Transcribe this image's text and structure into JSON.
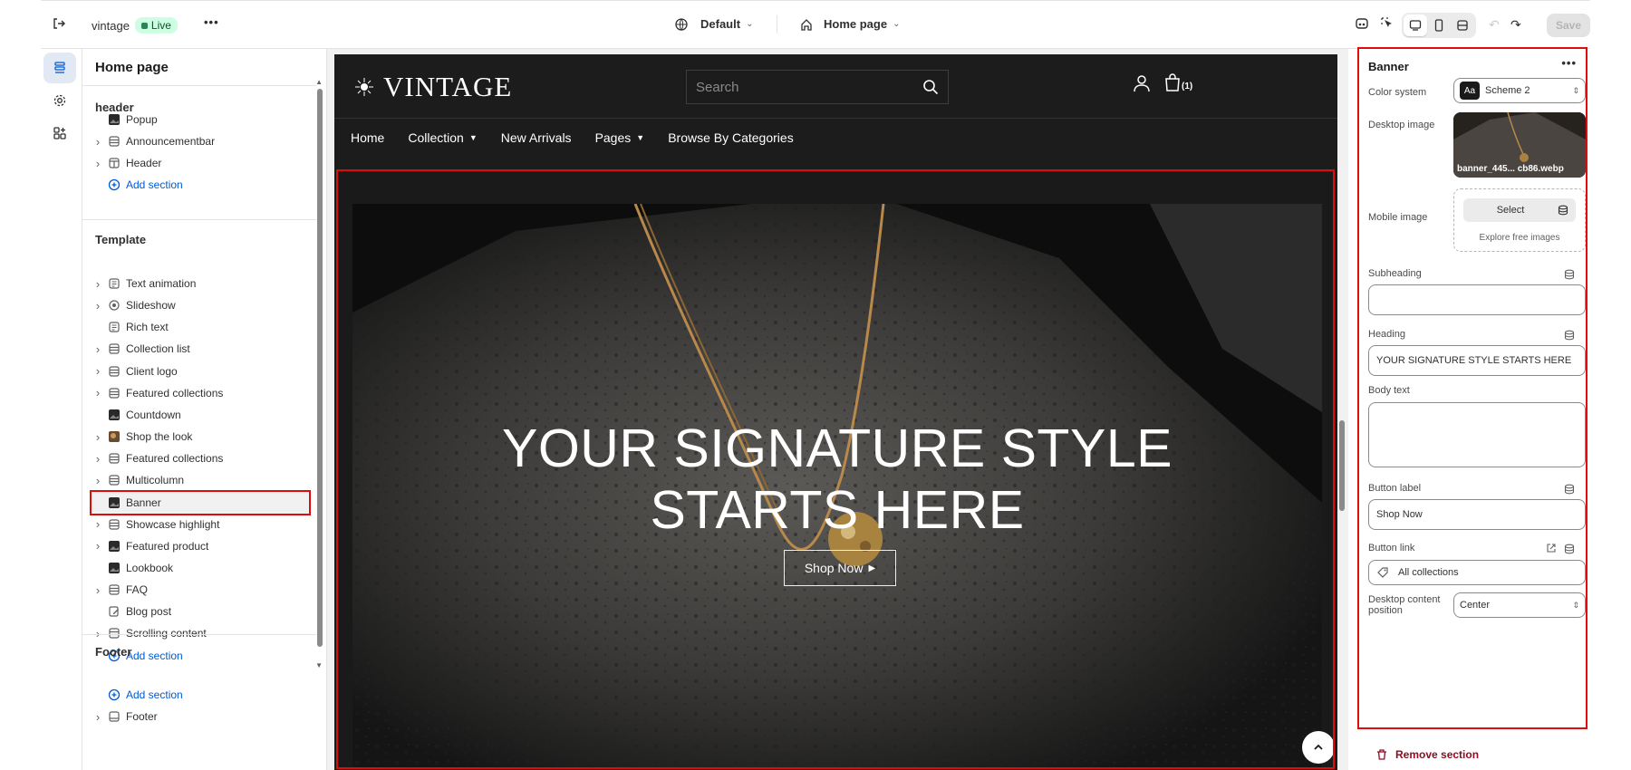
{
  "topbar": {
    "store_name": "vintage",
    "live_badge": "Live",
    "theme": "Default",
    "page": "Home page",
    "save_label": "Save"
  },
  "tree": {
    "title": "Home page",
    "header_group": {
      "title": "header",
      "items": [
        {
          "label": "Popup",
          "icon": "image-dark-icon",
          "expandable": false
        },
        {
          "label": "Announcementbar",
          "icon": "section-icon",
          "expandable": true
        },
        {
          "label": "Header",
          "icon": "header-layout-icon",
          "expandable": true
        },
        {
          "label": "Add section",
          "icon": "add-circle-icon",
          "add": true
        }
      ]
    },
    "template_group": {
      "title": "Template",
      "items": [
        {
          "label": "Text animation",
          "icon": "text-block-icon",
          "expandable": true
        },
        {
          "label": "Slideshow",
          "icon": "slideshow-icon",
          "expandable": true
        },
        {
          "label": "Rich text",
          "icon": "text-block-icon",
          "expandable": false
        },
        {
          "label": "Collection list",
          "icon": "section-icon",
          "expandable": true
        },
        {
          "label": "Client logo",
          "icon": "section-icon",
          "expandable": true
        },
        {
          "label": "Featured collections",
          "icon": "section-icon",
          "expandable": true
        },
        {
          "label": "Countdown",
          "icon": "image-dark-icon",
          "expandable": false
        },
        {
          "label": "Shop the look",
          "icon": "image-color-icon",
          "expandable": true
        },
        {
          "label": "Featured collections",
          "icon": "section-icon",
          "expandable": true
        },
        {
          "label": "Multicolumn",
          "icon": "section-icon",
          "expandable": true
        },
        {
          "label": "Banner",
          "icon": "image-dark-icon",
          "expandable": false,
          "selected": true
        },
        {
          "label": "Showcase highlight",
          "icon": "section-icon",
          "expandable": true
        },
        {
          "label": "Featured product",
          "icon": "image-dark-icon",
          "expandable": true
        },
        {
          "label": "Lookbook",
          "icon": "image-dark-icon",
          "expandable": false
        },
        {
          "label": "FAQ",
          "icon": "section-icon",
          "expandable": true
        },
        {
          "label": "Blog post",
          "icon": "edit-doc-icon",
          "expandable": false
        },
        {
          "label": "Scrolling content",
          "icon": "section-icon",
          "expandable": true
        },
        {
          "label": "Add section",
          "icon": "add-circle-icon",
          "add": true
        }
      ]
    },
    "footer_group": {
      "title": "Footer",
      "items": [
        {
          "label": "Add section",
          "icon": "add-circle-icon",
          "add": true
        },
        {
          "label": "Footer",
          "icon": "footer-layout-icon",
          "expandable": true
        }
      ]
    }
  },
  "store": {
    "logo": "VINTAGE",
    "search_placeholder": "Search",
    "cart_count": "(1)",
    "nav": [
      "Home",
      "Collection",
      "New Arrivals",
      "Pages",
      "Browse By Categories"
    ],
    "nav_dropdowns": [
      false,
      true,
      false,
      true,
      false
    ],
    "hero_heading_line1": "YOUR SIGNATURE STYLE",
    "hero_heading_line2": "STARTS HERE",
    "hero_button": "Shop Now"
  },
  "settings": {
    "title": "Banner",
    "color_system_label": "Color system",
    "color_system_value": "Scheme 2",
    "color_swatch_text": "Aa",
    "desktop_image_label": "Desktop image",
    "desktop_image_name": "banner_445... cb86.webp",
    "mobile_image_label": "Mobile image",
    "select_label": "Select",
    "explore_label": "Explore free images",
    "subheading_label": "Subheading",
    "subheading_value": "",
    "heading_label": "Heading",
    "heading_value": "YOUR SIGNATURE STYLE STARTS HERE",
    "body_label": "Body text",
    "body_value": "",
    "button_label_label": "Button label",
    "button_label_value": "Shop Now",
    "button_link_label": "Button link",
    "button_link_value": "All collections",
    "position_label_1": "Desktop content",
    "position_label_2": "position",
    "position_value": "Center",
    "remove_label": "Remove section"
  },
  "colors": {
    "highlight": "#e00b0b",
    "link_blue": "#005bd3",
    "remove_red": "#8e0b21",
    "store_bg": "#1c1c1c"
  }
}
